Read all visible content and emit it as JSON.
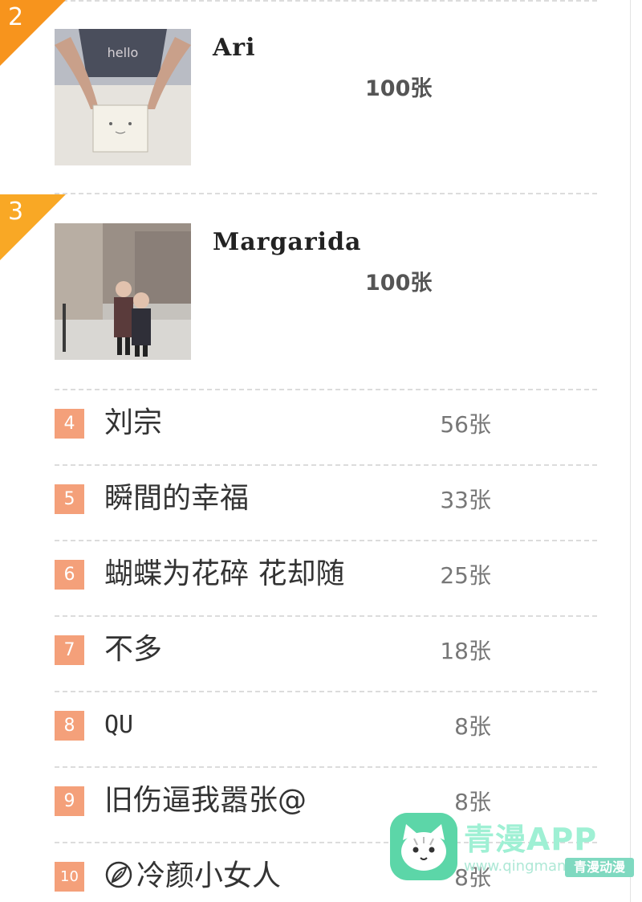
{
  "featured": [
    {
      "rank": "2",
      "name": "Ari",
      "count": "100张",
      "ribbon_color": "#f7941d"
    },
    {
      "rank": "3",
      "name": "Margarida",
      "count": "100张",
      "ribbon_color": "#f9a825"
    }
  ],
  "list": [
    {
      "rank": "4",
      "name": "刘宗",
      "count": "56张"
    },
    {
      "rank": "5",
      "name": "瞬間的幸福",
      "count": "33张"
    },
    {
      "rank": "6",
      "name": "蝴蝶为花碎 花却随",
      "count": "25张"
    },
    {
      "rank": "7",
      "name": "不多",
      "count": "18张"
    },
    {
      "rank": "8",
      "name": "QU",
      "count": "8张"
    },
    {
      "rank": "9",
      "name": "旧伤逼我嚣张@",
      "count": "8张"
    },
    {
      "rank": "10",
      "name": "冷颜小女人",
      "count": "8张",
      "icon": "leaf-icon"
    }
  ],
  "colors": {
    "rank_badge": "#f4a07a",
    "ribbon": "#f7941d",
    "divider": "#dcdcdc"
  },
  "watermark": {
    "title": "青漫APP",
    "url": "www.qingman.app",
    "stamp": "青漫动漫"
  }
}
